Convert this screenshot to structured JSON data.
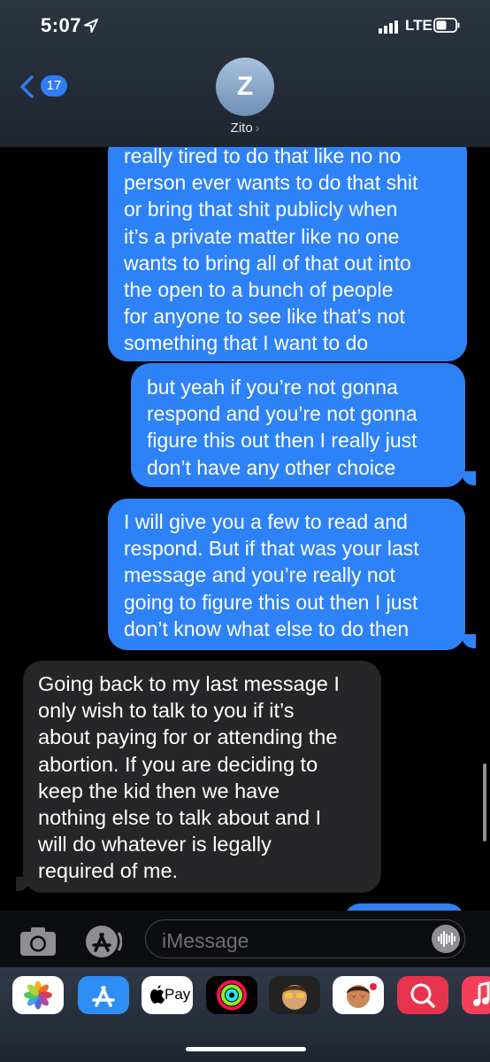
{
  "status": {
    "time": "5:07",
    "network": "LTE"
  },
  "nav": {
    "back_count": "17",
    "contact_initial": "Z",
    "contact_name": "Zito"
  },
  "messages": [
    {
      "lines": [
        "really tired to do that like no no",
        "person ever wants to do that shit",
        "or bring that shit publicly when",
        "it’s a private matter like no one",
        "wants to bring all of that out into",
        "the open to a bunch of people",
        "for anyone to see like that’s not",
        "something that I want to do"
      ]
    },
    {
      "lines": [
        "but yeah if you’re not gonna",
        "respond and you’re not gonna",
        "figure this out then I really just",
        "don’t have any other choice"
      ]
    },
    {
      "lines": [
        "I will give you a few to read and",
        "respond. But if that was your last",
        "message and you’re really not",
        "going to figure this out then I just",
        "don’t know what else to do then"
      ]
    },
    {
      "lines": [
        "Going back to my last message I",
        "only wish to talk to you if it’s",
        "about paying for or attending the",
        "abortion. If you are deciding to",
        "keep the kid then we have",
        "nothing else to talk about and I",
        "will do whatever is legally",
        "required of me."
      ]
    }
  ],
  "input": {
    "placeholder": "iMessage"
  },
  "app_tray": {
    "apple_pay_label": "Pay"
  },
  "colors": {
    "outgoing": "#2e82f8",
    "incoming": "#262629",
    "header": "#2b3441"
  }
}
